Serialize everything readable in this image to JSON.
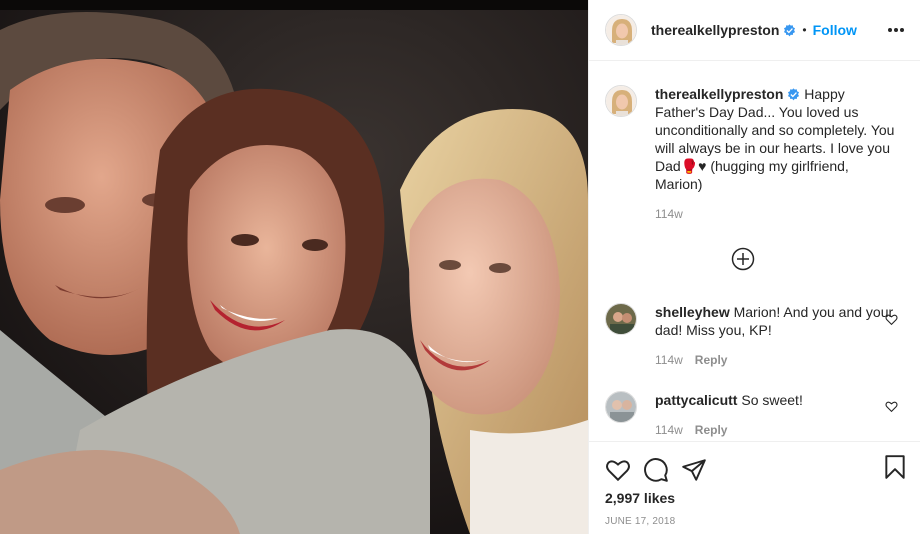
{
  "post": {
    "username": "therealkellypreston",
    "follow_label": "Follow",
    "separator": "•"
  },
  "caption": {
    "username": "therealkellypreston",
    "text": "Happy Father's Day Dad... You loved us unconditionally and so completely. You will always be in our hearts. I love you Dad🥊♥ (hugging my girlfriend, Marion)",
    "time": "114w"
  },
  "comments": [
    {
      "username": "shelleyhew",
      "text": "Marion! And you and your dad! Miss you, KP!",
      "time": "114w",
      "reply_label": "Reply"
    },
    {
      "username": "pattycalicutt",
      "text": "So sweet!",
      "time": "114w",
      "reply_label": "Reply"
    }
  ],
  "footer": {
    "likes": "2,997 likes",
    "date": "JUNE 17, 2018"
  },
  "colors": {
    "accent": "#0095f6",
    "verified": "#3897f0",
    "meta": "#8e8e8e"
  },
  "icons": [
    "verified-badge-icon",
    "more-options-icon",
    "load-more-icon",
    "heart-icon",
    "comment-icon",
    "share-icon",
    "save-icon"
  ]
}
